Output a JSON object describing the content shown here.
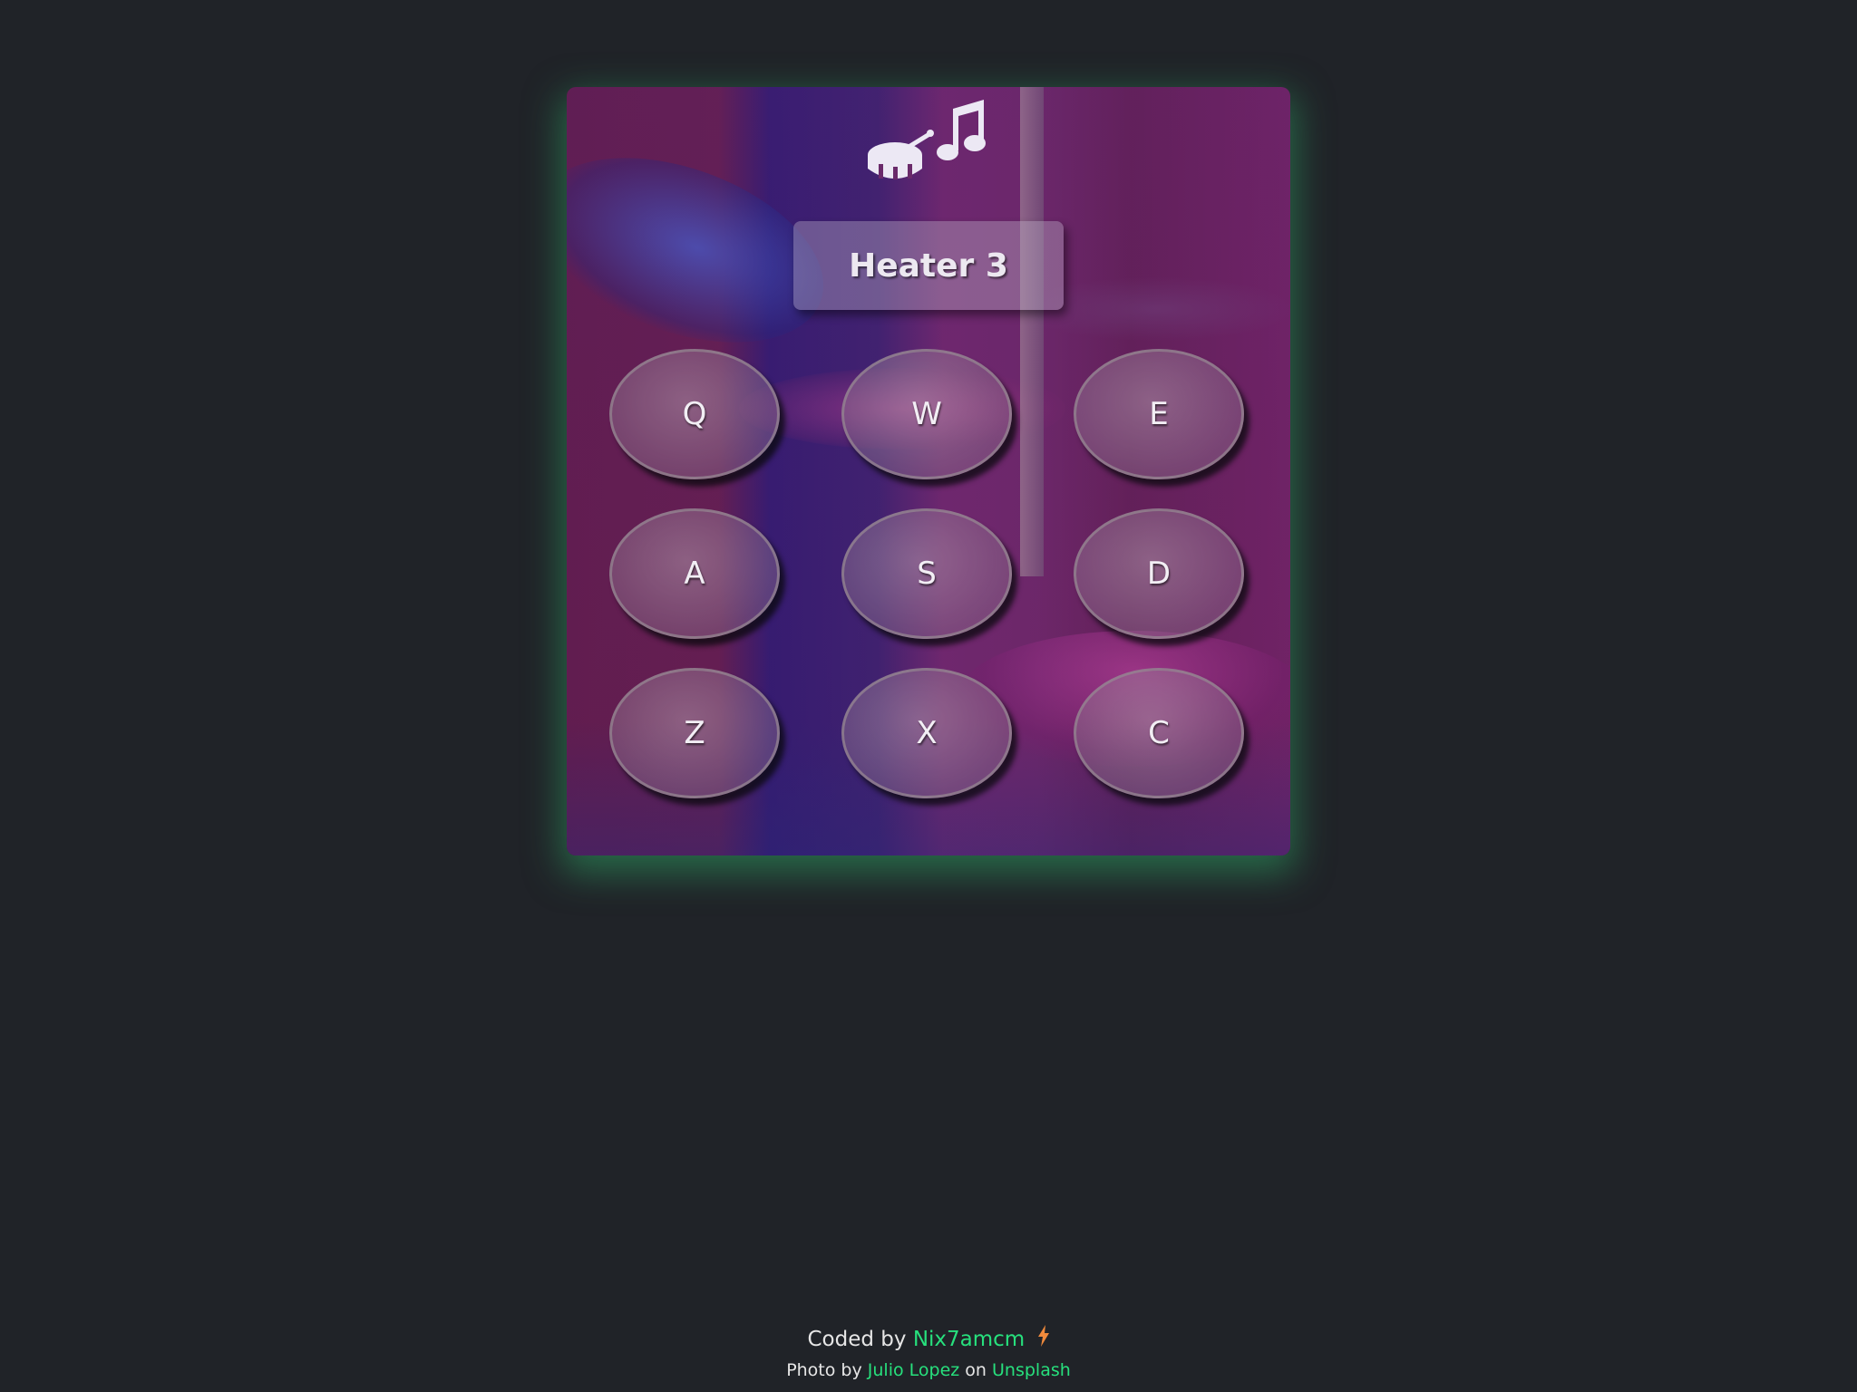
{
  "display": {
    "text": "Heater 3"
  },
  "logo": {
    "icons": [
      "drum-icon",
      "music-note-icon"
    ]
  },
  "pads": [
    {
      "key": "Q"
    },
    {
      "key": "W"
    },
    {
      "key": "E"
    },
    {
      "key": "A"
    },
    {
      "key": "S"
    },
    {
      "key": "D"
    },
    {
      "key": "Z"
    },
    {
      "key": "X"
    },
    {
      "key": "C"
    }
  ],
  "footer": {
    "coded_by_prefix": "Coded by",
    "author": "Nix7amcm",
    "bolt_icon": "lightning-bolt-icon",
    "photo_prefix": "Photo by",
    "photographer": "Julio Lopez",
    "on_text": "on",
    "source": "Unsplash"
  },
  "colors": {
    "page_background": "#202328",
    "accent_green": "#27e07d",
    "bolt_orange": "#f08a3c"
  }
}
